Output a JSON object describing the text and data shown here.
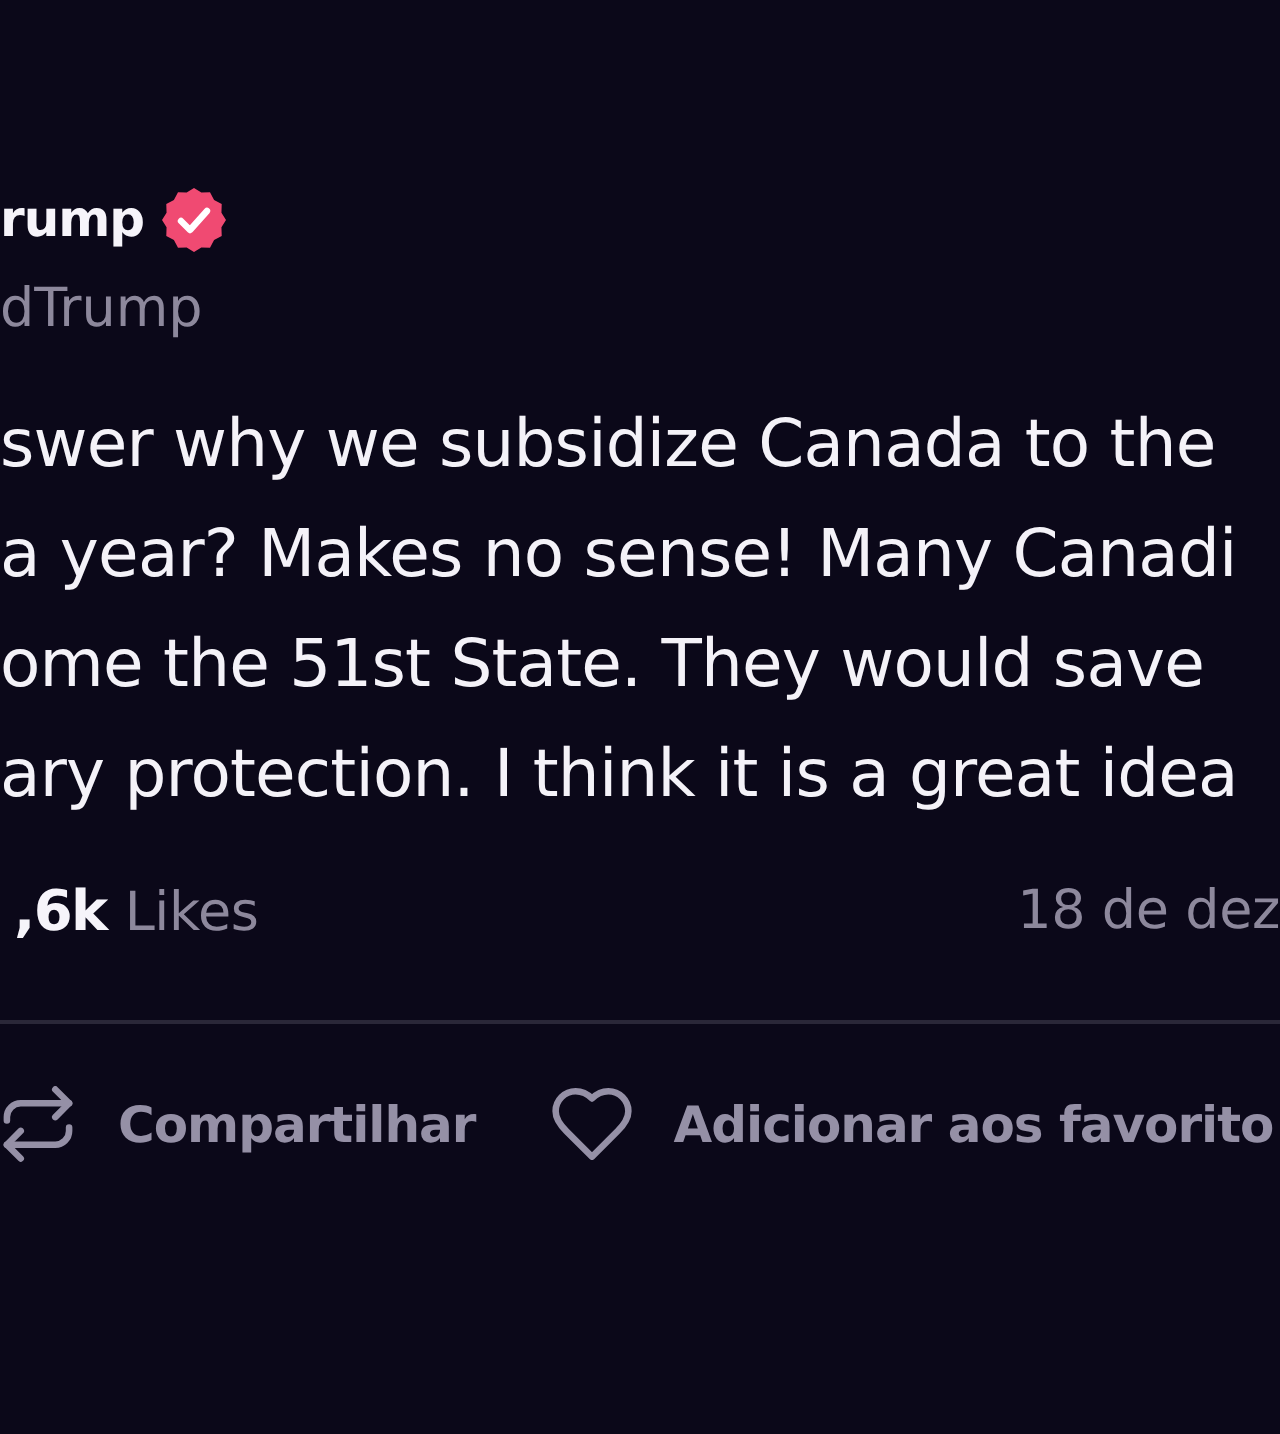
{
  "author": {
    "name": "rump",
    "verified": true,
    "handle": "dTrump"
  },
  "post": {
    "text_lines": [
      "swer why we subsidize Canada to the",
      "a year? Makes no sense! Many Canadi",
      "ome the 51st State. They would save",
      "ary protection. I think it is a great idea"
    ]
  },
  "stats": {
    "likes_count": ",6k",
    "likes_label": "Likes",
    "date": "18 de dez"
  },
  "actions": [
    {
      "kind": "share",
      "label": "Compartilhar"
    },
    {
      "kind": "favorite",
      "label": "Adicionar aos favorito"
    }
  ]
}
